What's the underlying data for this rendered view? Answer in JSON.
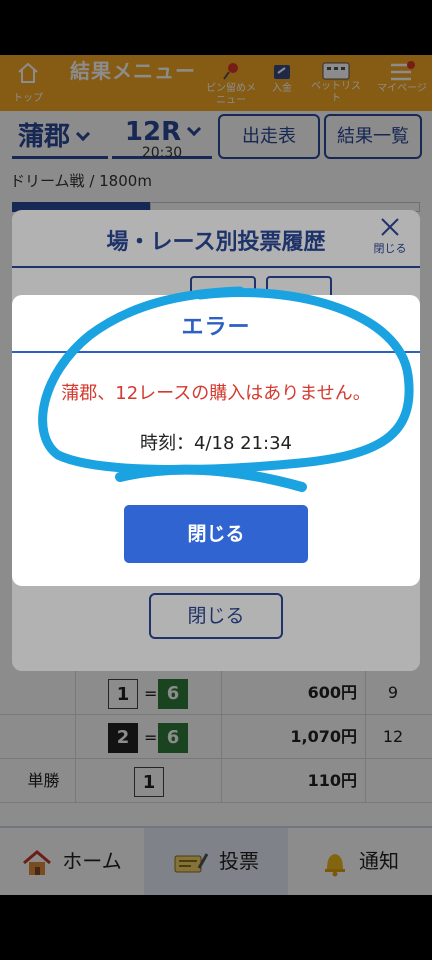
{
  "header": {
    "home_label": "トップ",
    "title": "結果メニュー",
    "items": [
      {
        "label": "ピン留めメニュー",
        "icon": "pin-icon"
      },
      {
        "label": "入金",
        "icon": "wallet-icon"
      },
      {
        "label": "ベットリスト",
        "icon": "betlist-icon"
      },
      {
        "label": "マイページ",
        "icon": "menu-icon"
      }
    ]
  },
  "race": {
    "venue": "蒲郡",
    "race_no": "12R",
    "time": "20:30",
    "entry_table_label": "出走表",
    "results_list_label": "結果一覧",
    "subinfo": "ドリーム戦 / 1800m"
  },
  "results": {
    "rows": [
      {
        "bet_type": "",
        "nums": [
          "1",
          "6"
        ],
        "payout": "600円",
        "popularity": "9"
      },
      {
        "bet_type": "",
        "nums": [
          "2",
          "6"
        ],
        "payout": "1,070円",
        "popularity": "12"
      },
      {
        "bet_type": "単勝",
        "nums": [
          "1"
        ],
        "payout": "110円",
        "popularity": ""
      }
    ]
  },
  "history_modal": {
    "title": "場・レース別投票履歴",
    "close_x_label": "閉じる",
    "close_button": "閉じる"
  },
  "error_modal": {
    "title": "エラー",
    "message": "蒲郡、12レースの購入はありません。",
    "time": "時刻：4/18 21:34",
    "close_button": "閉じる"
  },
  "bottom_nav": [
    {
      "label": "ホーム",
      "icon": "home-icon"
    },
    {
      "label": "投票",
      "icon": "ticket-icon"
    },
    {
      "label": "通知",
      "icon": "bell-icon"
    }
  ],
  "colors": {
    "header": "#f5a623",
    "primary": "#2d4a9a",
    "button": "#3065d1",
    "error_text": "#d43a2f",
    "scribble": "#1aa3e0"
  }
}
